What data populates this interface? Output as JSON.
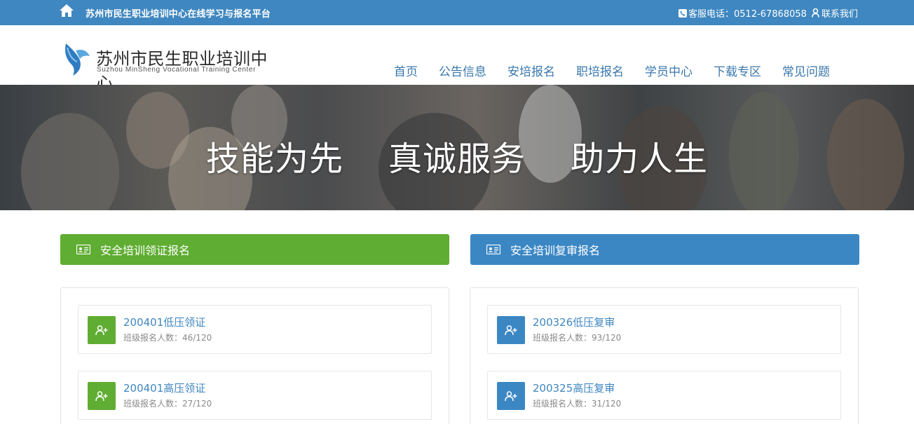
{
  "topbar": {
    "title": "苏州市民生职业培训中心在线学习与报名平台",
    "phone_label": "客服电话：0512-67868058",
    "contact_label": "联系我们"
  },
  "logo": {
    "cn": "苏州市民生职业培训中心",
    "en": "Suzhou MinSheng Vocational Training Center"
  },
  "nav": [
    "首页",
    "公告信息",
    "安培报名",
    "职培报名",
    "学员中心",
    "下载专区",
    "常见问题"
  ],
  "banner": {
    "slogan": [
      "技能为先",
      "真诚服务",
      "助力人生"
    ]
  },
  "sections": {
    "left_label": "安全培训领证报名",
    "right_label": "安全培训复审报名"
  },
  "left_items": [
    {
      "title": "200401低压领证",
      "count": "班级报名人数：46/120"
    },
    {
      "title": "200401高压领证",
      "count": "班级报名人数：27/120"
    }
  ],
  "right_items": [
    {
      "title": "200326低压复审",
      "count": "班级报名人数：93/120"
    },
    {
      "title": "200325高压复审",
      "count": "班级报名人数：31/120"
    }
  ],
  "colors": {
    "topbar": "#3f87c0",
    "green": "#5fad32",
    "blue": "#3b87c4",
    "nav_text": "#3a78ad"
  }
}
